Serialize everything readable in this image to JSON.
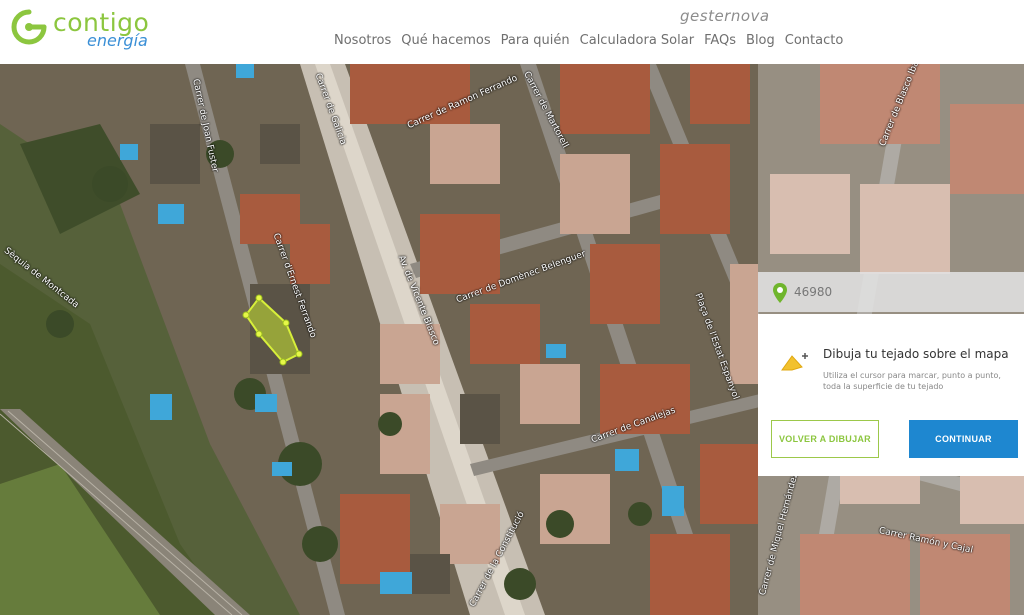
{
  "header": {
    "logo_word1": "contigo",
    "logo_word2": "energía",
    "partner": "gesternova",
    "nav": [
      "Nosotros",
      "Qué hacemos",
      "Para quién",
      "Calculadora Solar",
      "FAQs",
      "Blog",
      "Contacto"
    ]
  },
  "map": {
    "street_labels": [
      "Carrer de Ramon Ferrando",
      "Carrer de Domènec Belenguer",
      "Carrer d'Ernest Ferrando",
      "Av. de Vicente Blasco",
      "Carrer de Canalejas",
      "Carrer Ramón y Cajal",
      "Carrer de Miquel Hernández",
      "Plaça de l'Estat Espanyol",
      "Carrer de Joan Fuster",
      "Carrer de Martorell",
      "Carrer de Blasco Ibáñez",
      "Sèquia de Montcada",
      "Carrer de la Constitució",
      "Carrer de Galicia"
    ]
  },
  "panel": {
    "postal_code": "46980",
    "title": "Dibuja tu tejado sobre el mapa",
    "subtitle": "Utiliza el cursor para marcar, punto a punto, toda la superficie de tu tejado",
    "back_button": "VOLVER A DIBUJAR",
    "continue_button": "CONTINUAR"
  },
  "colors": {
    "brand_green": "#8cc63f",
    "brand_blue": "#3a8fd6",
    "button_blue": "#1e87d0",
    "roof_polygon": "#c8e632"
  },
  "icons": [
    "logo-ring-icon",
    "map-pin-icon",
    "draw-roof-icon"
  ]
}
